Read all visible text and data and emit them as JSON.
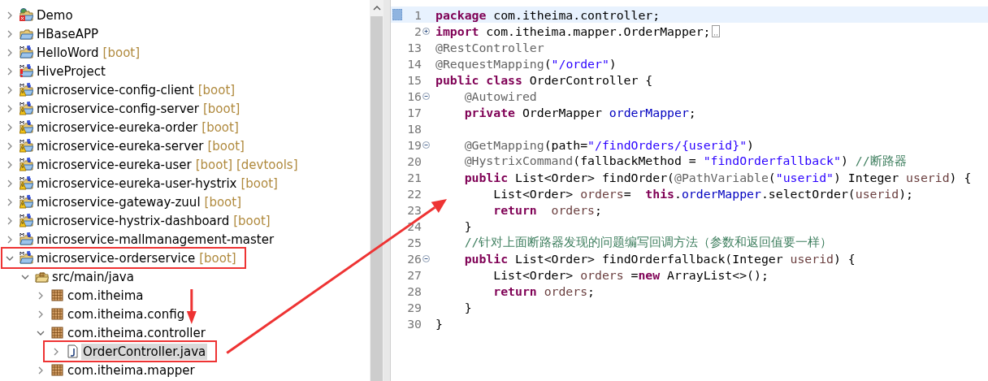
{
  "project_tree": {
    "items": [
      {
        "label": "Demo",
        "kind": "web-error",
        "expanded": false,
        "selected": false,
        "callout": false
      },
      {
        "label": "HBaseAPP",
        "kind": "project",
        "expanded": false,
        "selected": false,
        "callout": false
      },
      {
        "label": "HelloWord",
        "suffix": "[boot]",
        "kind": "maven",
        "expanded": false,
        "selected": false,
        "callout": false
      },
      {
        "label": "HiveProject",
        "kind": "maven-error",
        "expanded": false,
        "selected": false,
        "callout": false
      },
      {
        "label": "microservice-config-client",
        "suffix": "[boot]",
        "kind": "maven-warning",
        "expanded": false,
        "selected": false,
        "callout": false
      },
      {
        "label": "microservice-config-server",
        "suffix": "[boot]",
        "kind": "maven-warning",
        "expanded": false,
        "selected": false,
        "callout": false
      },
      {
        "label": "microservice-eureka-order",
        "suffix": "[boot]",
        "kind": "maven-warning",
        "expanded": false,
        "selected": false,
        "callout": false
      },
      {
        "label": "microservice-eureka-server",
        "suffix": "[boot]",
        "kind": "maven-warning",
        "expanded": false,
        "selected": false,
        "callout": false
      },
      {
        "label": "microservice-eureka-user",
        "suffix": "[boot] [devtools]",
        "kind": "maven-warning",
        "expanded": false,
        "selected": false,
        "callout": false
      },
      {
        "label": "microservice-eureka-user-hystrix",
        "suffix": "[boot]",
        "kind": "maven-warning",
        "expanded": false,
        "selected": false,
        "callout": false
      },
      {
        "label": "microservice-gateway-zuul",
        "suffix": "[boot]",
        "kind": "maven-warning",
        "expanded": false,
        "selected": false,
        "callout": false
      },
      {
        "label": "microservice-hystrix-dashboard",
        "suffix": "[boot]",
        "kind": "maven-warning",
        "expanded": false,
        "selected": false,
        "callout": false
      },
      {
        "label": "microservice-mallmanagement-master",
        "kind": "maven",
        "expanded": false,
        "selected": false,
        "callout": false
      },
      {
        "label": "microservice-orderservice",
        "suffix": "[boot]",
        "kind": "maven",
        "expanded": true,
        "selected": false,
        "callout": true,
        "children": [
          {
            "label": "src/main/java",
            "kind": "source-folder",
            "expanded": true,
            "selected": false,
            "callout": false,
            "children": [
              {
                "label": "com.itheima",
                "kind": "package",
                "expanded": false,
                "selected": false,
                "callout": false
              },
              {
                "label": "com.itheima.config",
                "kind": "package",
                "expanded": false,
                "selected": false,
                "callout": false
              },
              {
                "label": "com.itheima.controller",
                "kind": "package",
                "expanded": true,
                "selected": false,
                "callout": false,
                "children": [
                  {
                    "label": "OrderController.java",
                    "kind": "java-file",
                    "expanded": false,
                    "selected": true,
                    "callout": true
                  }
                ]
              },
              {
                "label": "com.itheima.mapper",
                "kind": "package",
                "expanded": false,
                "selected": false,
                "callout": false
              }
            ]
          }
        ]
      }
    ]
  },
  "editor": {
    "lines": [
      {
        "number": "1",
        "current": true,
        "tokens": [
          {
            "kind": "keyword",
            "text": "package"
          },
          {
            "kind": "plain",
            "text": " com.itheima.controller;"
          }
        ]
      },
      {
        "number": "2",
        "fold_expanded": false,
        "current": false,
        "folded_marker": true,
        "tokens": [
          {
            "kind": "keyword",
            "text": "import"
          },
          {
            "kind": "plain",
            "text": " com.itheima.mapper.OrderMapper;"
          }
        ]
      },
      {
        "number": "13",
        "current": false,
        "tokens": [
          {
            "kind": "annotation",
            "text": "@RestController"
          }
        ]
      },
      {
        "number": "14",
        "current": false,
        "tokens": [
          {
            "kind": "annotation",
            "text": "@RequestMapping"
          },
          {
            "kind": "plain",
            "text": "("
          },
          {
            "kind": "string",
            "text": "\"/order\""
          },
          {
            "kind": "plain",
            "text": ")"
          }
        ]
      },
      {
        "number": "15",
        "current": false,
        "tokens": [
          {
            "kind": "keyword",
            "text": "public"
          },
          {
            "kind": "keyword",
            "text": " class"
          },
          {
            "kind": "plain",
            "text": " OrderController {"
          }
        ]
      },
      {
        "number": "16",
        "fold_expanded": true,
        "current": false,
        "tokens": [
          {
            "kind": "annotation",
            "text": "    @Autowired"
          }
        ]
      },
      {
        "number": "17",
        "current": false,
        "tokens": [
          {
            "kind": "keyword",
            "text": "    private"
          },
          {
            "kind": "plain",
            "text": " OrderMapper "
          },
          {
            "kind": "field",
            "text": "orderMapper"
          },
          {
            "kind": "plain",
            "text": ";"
          }
        ]
      },
      {
        "number": "18",
        "current": false
      },
      {
        "number": "19",
        "fold_expanded": true,
        "current": false,
        "tokens": [
          {
            "kind": "annotation",
            "text": "    @GetMapping"
          },
          {
            "kind": "plain",
            "text": "(path="
          },
          {
            "kind": "string",
            "text": "\"/findOrders/{userid}\""
          },
          {
            "kind": "plain",
            "text": ")"
          }
        ]
      },
      {
        "number": "20",
        "current": false,
        "tokens": [
          {
            "kind": "annotation",
            "text": "    @HystrixCommand"
          },
          {
            "kind": "plain",
            "text": "(fallbackMethod = "
          },
          {
            "kind": "string",
            "text": "\"findOrderfallback\""
          },
          {
            "kind": "plain",
            "text": ")"
          },
          {
            "kind": "comment",
            "text": " //断路器"
          }
        ]
      },
      {
        "number": "21",
        "current": false,
        "tokens": [
          {
            "kind": "keyword",
            "text": "    public"
          },
          {
            "kind": "plain",
            "text": " List<Order> findOrder("
          },
          {
            "kind": "annotation",
            "text": "@PathVariable"
          },
          {
            "kind": "plain",
            "text": "("
          },
          {
            "kind": "string",
            "text": "\"userid\""
          },
          {
            "kind": "plain",
            "text": ") Integer "
          },
          {
            "kind": "local",
            "text": "userid"
          },
          {
            "kind": "plain",
            "text": ") {"
          }
        ]
      },
      {
        "number": "22",
        "current": false,
        "tokens": [
          {
            "kind": "plain",
            "text": "        List<Order> "
          },
          {
            "kind": "local",
            "text": "orders"
          },
          {
            "kind": "plain",
            "text": "=  "
          },
          {
            "kind": "keyword",
            "text": "this"
          },
          {
            "kind": "plain",
            "text": "."
          },
          {
            "kind": "field",
            "text": "orderMapper"
          },
          {
            "kind": "plain",
            "text": ".selectOrder("
          },
          {
            "kind": "local",
            "text": "userid"
          },
          {
            "kind": "plain",
            "text": ");"
          }
        ]
      },
      {
        "number": "23",
        "current": false,
        "tokens": [
          {
            "kind": "keyword",
            "text": "        return"
          },
          {
            "kind": "local",
            "text": "  orders"
          },
          {
            "kind": "plain",
            "text": ";"
          }
        ]
      },
      {
        "number": "24",
        "current": false,
        "tokens": [
          {
            "kind": "plain",
            "text": "    }"
          }
        ]
      },
      {
        "number": "25",
        "current": false,
        "tokens": [
          {
            "kind": "comment",
            "text": "    //针对上面断路器发现的问题编写回调方法（参数和返回值要一样）"
          }
        ]
      },
      {
        "number": "26",
        "fold_expanded": true,
        "current": false,
        "tokens": [
          {
            "kind": "keyword",
            "text": "    public"
          },
          {
            "kind": "plain",
            "text": " List<Order> findOrderfallback(Integer "
          },
          {
            "kind": "local",
            "text": "userid"
          },
          {
            "kind": "plain",
            "text": ") {"
          }
        ]
      },
      {
        "number": "27",
        "current": false,
        "tokens": [
          {
            "kind": "plain",
            "text": "        List<Order> "
          },
          {
            "kind": "local",
            "text": "orders"
          },
          {
            "kind": "plain",
            "text": " ="
          },
          {
            "kind": "keyword",
            "text": "new"
          },
          {
            "kind": "plain",
            "text": " ArrayList<>();"
          }
        ]
      },
      {
        "number": "28",
        "current": false,
        "tokens": [
          {
            "kind": "keyword",
            "text": "        return"
          },
          {
            "kind": "local",
            "text": " orders"
          },
          {
            "kind": "plain",
            "text": ";"
          }
        ]
      },
      {
        "number": "29",
        "current": false,
        "tokens": [
          {
            "kind": "plain",
            "text": "    }"
          }
        ]
      },
      {
        "number": "30",
        "current": false,
        "tokens": [
          {
            "kind": "plain",
            "text": "}"
          }
        ]
      }
    ]
  }
}
